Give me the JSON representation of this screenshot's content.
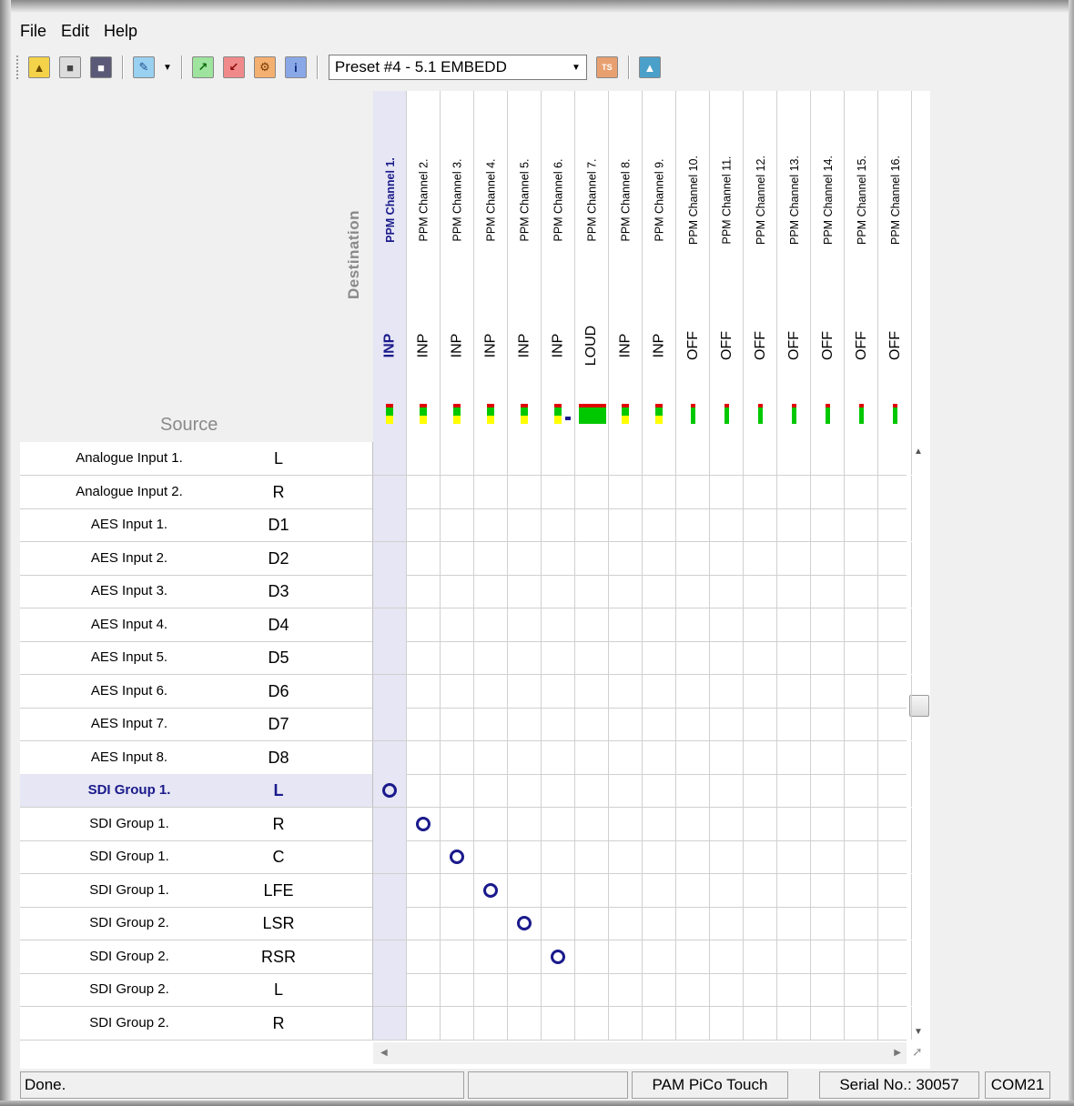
{
  "menu": {
    "file": "File",
    "edit": "Edit",
    "help": "Help"
  },
  "toolbar": {
    "preset": "Preset #4 - 5.1 EMBEDD",
    "icons": [
      "open-folder-icon",
      "save-disk-icon",
      "save-as-icon",
      "edit-icon",
      "export-icon",
      "import-icon",
      "settings-icon",
      "info-icon",
      "tts-icon",
      "upload-icon"
    ]
  },
  "header": {
    "destination": "Destination",
    "source": "Source"
  },
  "columns": [
    {
      "name": "PPM Channel 1.",
      "mode": "INP",
      "meter": "full"
    },
    {
      "name": "PPM Channel 2.",
      "mode": "INP",
      "meter": "full"
    },
    {
      "name": "PPM Channel 3.",
      "mode": "INP",
      "meter": "full"
    },
    {
      "name": "PPM Channel 4.",
      "mode": "INP",
      "meter": "full"
    },
    {
      "name": "PPM Channel 5.",
      "mode": "INP",
      "meter": "full"
    },
    {
      "name": "PPM Channel 6.",
      "mode": "INP",
      "meter": "full"
    },
    {
      "name": "PPM Channel 7.",
      "mode": "LOUD",
      "meter": "wide"
    },
    {
      "name": "PPM Channel 8.",
      "mode": "INP",
      "meter": "full"
    },
    {
      "name": "PPM Channel 9.",
      "mode": "INP",
      "meter": "full"
    },
    {
      "name": "PPM Channel 10.",
      "mode": "OFF",
      "meter": "off"
    },
    {
      "name": "PPM Channel 11.",
      "mode": "OFF",
      "meter": "off"
    },
    {
      "name": "PPM Channel 12.",
      "mode": "OFF",
      "meter": "off"
    },
    {
      "name": "PPM Channel 13.",
      "mode": "OFF",
      "meter": "off"
    },
    {
      "name": "PPM Channel 14.",
      "mode": "OFF",
      "meter": "off"
    },
    {
      "name": "PPM Channel 15.",
      "mode": "OFF",
      "meter": "off"
    },
    {
      "name": "PPM Channel 16.",
      "mode": "OFF",
      "meter": "off"
    }
  ],
  "rows": [
    {
      "name": "Analogue Input 1.",
      "ch": "L",
      "route": -1
    },
    {
      "name": "Analogue Input 2.",
      "ch": "R",
      "route": -1
    },
    {
      "name": "AES Input 1.",
      "ch": "D1",
      "route": -1
    },
    {
      "name": "AES Input 2.",
      "ch": "D2",
      "route": -1
    },
    {
      "name": "AES Input 3.",
      "ch": "D3",
      "route": -1
    },
    {
      "name": "AES Input 4.",
      "ch": "D4",
      "route": -1
    },
    {
      "name": "AES Input 5.",
      "ch": "D5",
      "route": -1
    },
    {
      "name": "AES Input 6.",
      "ch": "D6",
      "route": -1
    },
    {
      "name": "AES Input 7.",
      "ch": "D7",
      "route": -1
    },
    {
      "name": "AES Input 8.",
      "ch": "D8",
      "route": -1
    },
    {
      "name": "SDI Group 1.",
      "ch": "L",
      "route": 0,
      "selected": true
    },
    {
      "name": "SDI Group 1.",
      "ch": "R",
      "route": 1
    },
    {
      "name": "SDI Group 1.",
      "ch": "C",
      "route": 2
    },
    {
      "name": "SDI Group 1.",
      "ch": "LFE",
      "route": 3
    },
    {
      "name": "SDI Group 2.",
      "ch": "LSR",
      "route": 4
    },
    {
      "name": "SDI Group 2.",
      "ch": "RSR",
      "route": 5
    },
    {
      "name": "SDI Group 2.",
      "ch": "L",
      "route": -1
    },
    {
      "name": "SDI Group 2.",
      "ch": "R",
      "route": -1
    }
  ],
  "status": {
    "message": "Done.",
    "empty": "",
    "device": "PAM PiCo Touch",
    "serial": "Serial No.: 30057",
    "port": "COM21"
  },
  "colors": {
    "accent": "#1a1a8c",
    "selection": "#e6e6f4"
  }
}
